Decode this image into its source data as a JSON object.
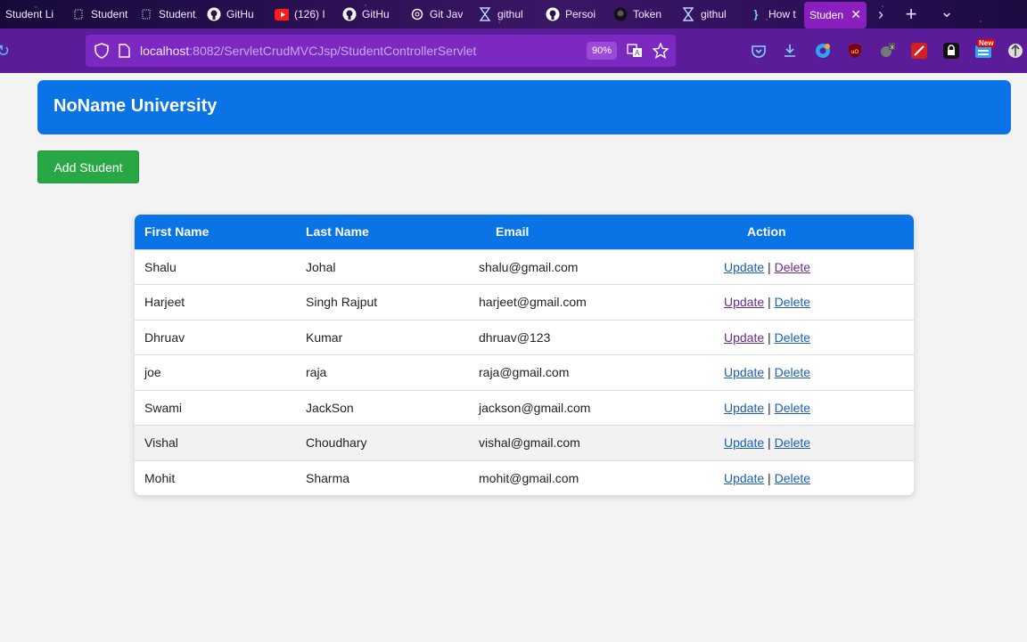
{
  "tabs": [
    {
      "label": "Student Li",
      "icon": "page-icon"
    },
    {
      "label": "Student Li",
      "icon": "page-icon"
    },
    {
      "label": "Student Li",
      "icon": "page-icon"
    },
    {
      "label": "GitHu",
      "icon": "github-icon"
    },
    {
      "label": "(126) I",
      "icon": "youtube-icon"
    },
    {
      "label": "GitHu",
      "icon": "github-icon"
    },
    {
      "label": "Git Jav",
      "icon": "openai-icon"
    },
    {
      "label": "githul",
      "icon": "hourglass-icon"
    },
    {
      "label": "Persoi",
      "icon": "github-icon"
    },
    {
      "label": "Token",
      "icon": "github-dark-icon"
    },
    {
      "label": "githul",
      "icon": "hourglass-icon"
    },
    {
      "label": "How t",
      "icon": "braces-icon"
    }
  ],
  "active_tab": {
    "label": "Student",
    "close": "✕"
  },
  "tab_controls": {
    "more": "›",
    "new": "+",
    "list": "⌄"
  },
  "url": {
    "host": "localhost",
    "rest": ":8082/ServletCrudMVCJsp/StudentControllerServlet"
  },
  "zoom": "90%",
  "ext_badge": "New",
  "header": {
    "title": "NoName University"
  },
  "add_button": "Add Student",
  "table": {
    "columns": [
      "First Name",
      "Last Name",
      "Email",
      "Action"
    ],
    "update_label": "Update",
    "delete_label": "Delete",
    "separator": "|",
    "rows": [
      {
        "first": "Shalu",
        "last": "Johal",
        "email": "shalu@gmail.com"
      },
      {
        "first": "Harjeet",
        "last": "Singh Rajput",
        "email": "harjeet@gmail.com"
      },
      {
        "first": "Dhruav",
        "last": "Kumar",
        "email": "dhruav@123"
      },
      {
        "first": "joe",
        "last": "raja",
        "email": "raja@gmail.com"
      },
      {
        "first": "Swami",
        "last": "JackSon",
        "email": "jackson@gmail.com"
      },
      {
        "first": "Vishal",
        "last": "Choudhary",
        "email": "vishal@gmail.com"
      },
      {
        "first": "Mohit",
        "last": "Sharma",
        "email": "mohit@gmail.com"
      }
    ]
  },
  "colors": {
    "brand": "#0a73e6",
    "success": "#28a745",
    "browser": "#5b1c9a"
  }
}
